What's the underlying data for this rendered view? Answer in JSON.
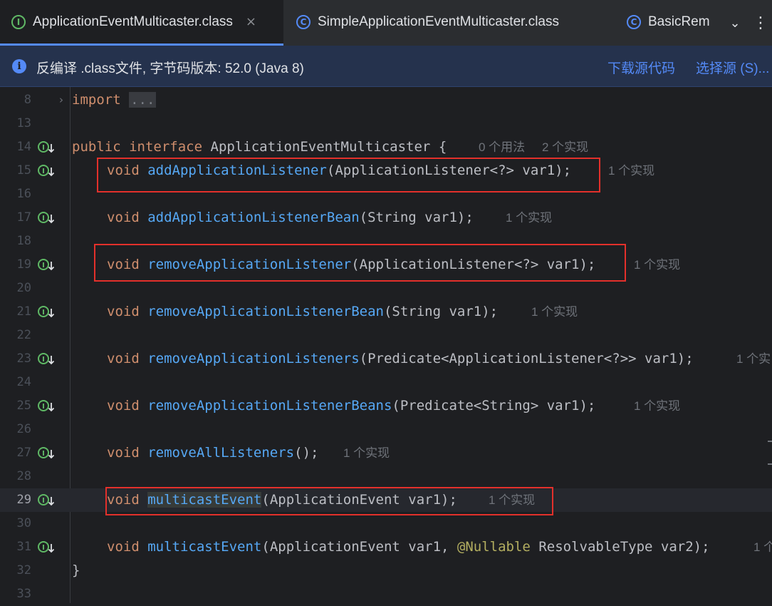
{
  "tabs": [
    {
      "label": "ApplicationEventMulticaster.class",
      "icon": "I",
      "icon_name": "interface-icon",
      "active": true
    },
    {
      "label": "SimpleApplicationEventMulticaster.class",
      "icon": "C",
      "icon_name": "class-icon",
      "active": false
    },
    {
      "label": "BasicRem",
      "icon": "C",
      "icon_name": "class-icon",
      "active": false
    }
  ],
  "tab_controls": {
    "close": "×",
    "dropdown": "⌄",
    "more": "⋮"
  },
  "banner": {
    "icon": "i",
    "text": "反编译 .class文件, 字节码版本: 52.0 (Java 8)",
    "download_link": "下载源代码",
    "choose_link": "选择源 (S)..."
  },
  "editor": {
    "lines": {
      "l8": {
        "num": "8",
        "kw": "import",
        "dots": "..."
      },
      "l13": {
        "num": "13"
      },
      "l14": {
        "num": "14",
        "kw1": "public",
        "kw2": "interface",
        "name": "ApplicationEventMulticaster",
        "brace": "{",
        "hint1": "0 个用法",
        "hint2": "2 个实现"
      },
      "l15": {
        "num": "15",
        "ret": "void",
        "fn": "addApplicationListener",
        "params": "(ApplicationListener<?> var1);",
        "hint": "1 个实现"
      },
      "l16": {
        "num": "16"
      },
      "l17": {
        "num": "17",
        "ret": "void",
        "fn": "addApplicationListenerBean",
        "params": "(String var1);",
        "hint": "1 个实现"
      },
      "l18": {
        "num": "18"
      },
      "l19": {
        "num": "19",
        "ret": "void",
        "fn": "removeApplicationListener",
        "params": "(ApplicationListener<?> var1);",
        "hint": "1 个实现"
      },
      "l20": {
        "num": "20"
      },
      "l21": {
        "num": "21",
        "ret": "void",
        "fn": "removeApplicationListenerBean",
        "params": "(String var1);",
        "hint": "1 个实现"
      },
      "l22": {
        "num": "22"
      },
      "l23": {
        "num": "23",
        "ret": "void",
        "fn": "removeApplicationListeners",
        "params": "(Predicate<ApplicationListener<?>> var1);",
        "hint": "1 个实"
      },
      "l24": {
        "num": "24"
      },
      "l25": {
        "num": "25",
        "ret": "void",
        "fn": "removeApplicationListenerBeans",
        "params": "(Predicate<String> var1);",
        "hint": "1 个实现"
      },
      "l26": {
        "num": "26"
      },
      "l27": {
        "num": "27",
        "ret": "void",
        "fn": "removeAllListeners",
        "params": "();",
        "hint": "1 个实现"
      },
      "l28": {
        "num": "28"
      },
      "l29": {
        "num": "29",
        "ret": "void",
        "fn": "multicastEvent",
        "params": "(ApplicationEvent var1);",
        "hint": "1 个实现"
      },
      "l30": {
        "num": "30"
      },
      "l31": {
        "num": "31",
        "ret": "void",
        "fn": "multicastEvent",
        "params_a": "(ApplicationEvent var1, ",
        "annotation": "@Nullable",
        "params_b": " ResolvableType var2);",
        "hint": "1 个"
      },
      "l32": {
        "num": "32",
        "brace": "}"
      },
      "l33": {
        "num": "33"
      }
    }
  },
  "colors": {
    "background": "#1e1f22",
    "keyword": "#cf8e6d",
    "method": "#56a8f5",
    "annotation": "#b3ae60",
    "hint": "#6f737a",
    "link": "#548af7",
    "highlight_box": "#e3302b",
    "implementation_icon": "#5fb865"
  }
}
